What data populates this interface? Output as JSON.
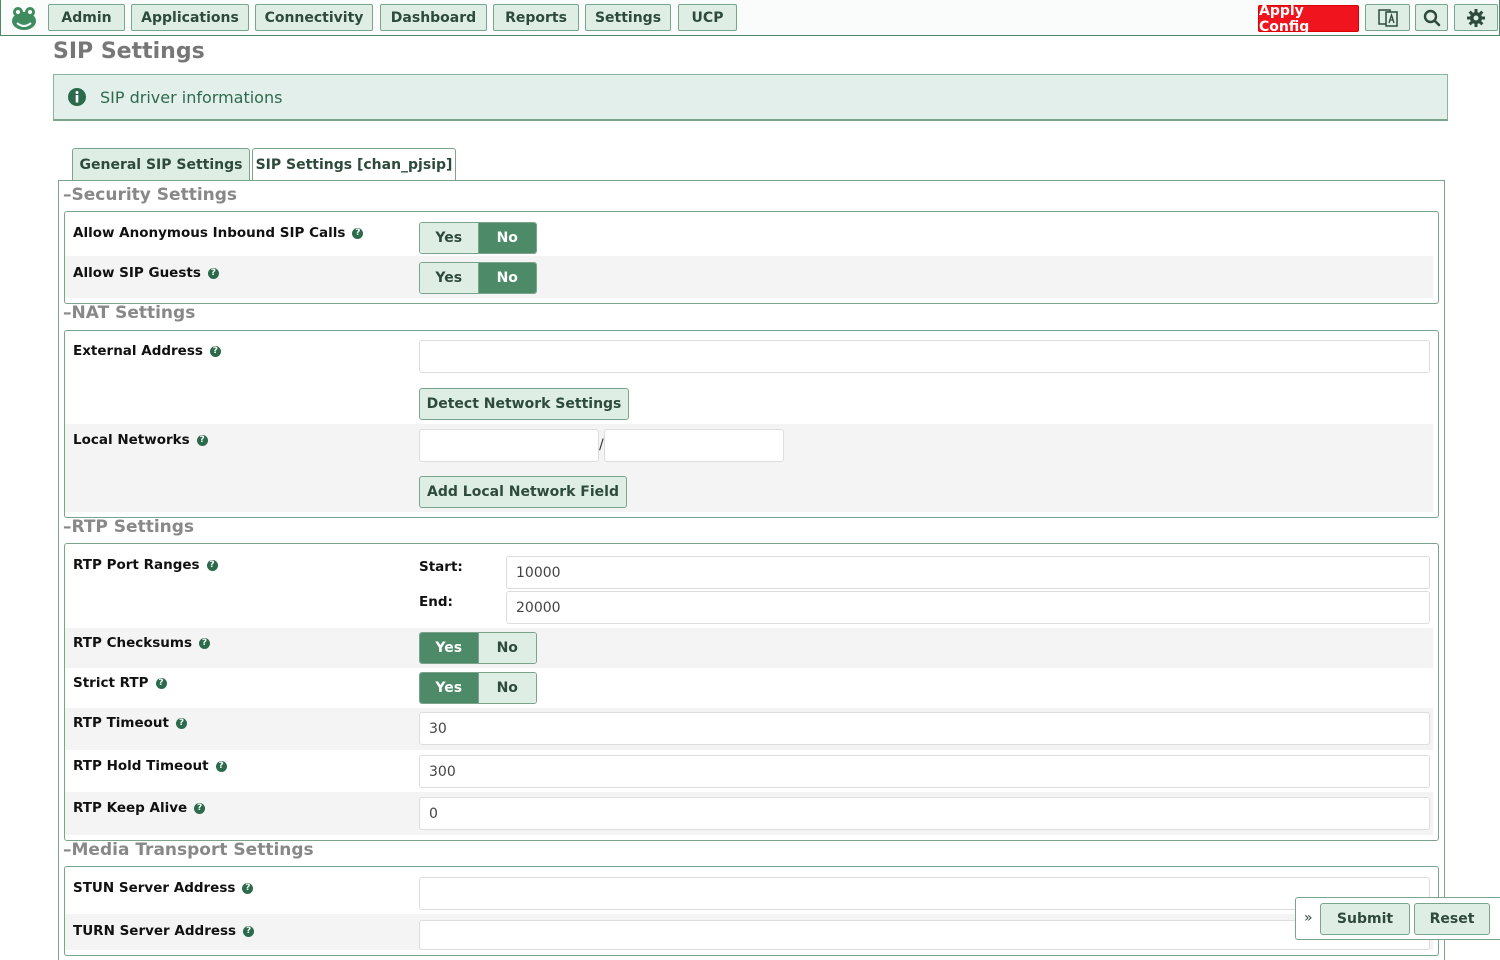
{
  "nav": {
    "items": [
      {
        "label": "Admin"
      },
      {
        "label": "Applications"
      },
      {
        "label": "Connectivity"
      },
      {
        "label": "Dashboard"
      },
      {
        "label": "Reports"
      },
      {
        "label": "Settings"
      },
      {
        "label": "UCP"
      }
    ],
    "apply_config": "Apply Config",
    "icons": [
      "logo-frog-icon",
      "language-icon",
      "search-icon",
      "gear-icon"
    ],
    "colors": {
      "accent": "#4d8a68",
      "apply": "#f0141e",
      "button_bg": "#dfeee5"
    }
  },
  "page": {
    "title": "SIP Settings",
    "info": "SIP driver informations"
  },
  "tabs": [
    {
      "label": "General SIP Settings",
      "active": true
    },
    {
      "label": "SIP Settings [chan_pjsip]",
      "active": false
    }
  ],
  "sections": {
    "security": {
      "title": "Security Settings",
      "anonymous": {
        "label": "Allow Anonymous Inbound SIP Calls",
        "yes": "Yes",
        "no": "No",
        "value": "No"
      },
      "guests": {
        "label": "Allow SIP Guests",
        "yes": "Yes",
        "no": "No",
        "value": "No"
      }
    },
    "nat": {
      "title": "NAT Settings",
      "external": {
        "label": "External Address",
        "value": ""
      },
      "detect_button": "Detect Network Settings",
      "local": {
        "label": "Local Networks",
        "network": "",
        "separator": "/",
        "mask": ""
      },
      "add_button": "Add Local Network Field"
    },
    "rtp": {
      "title": "RTP Settings",
      "ports": {
        "label": "RTP Port Ranges",
        "start_label": "Start:",
        "start": "10000",
        "end_label": "End:",
        "end": "20000"
      },
      "checksums": {
        "label": "RTP Checksums",
        "yes": "Yes",
        "no": "No",
        "value": "Yes"
      },
      "strict": {
        "label": "Strict RTP",
        "yes": "Yes",
        "no": "No",
        "value": "Yes"
      },
      "timeout": {
        "label": "RTP Timeout",
        "value": "30"
      },
      "hold_timeout": {
        "label": "RTP Hold Timeout",
        "value": "300"
      },
      "keep_alive": {
        "label": "RTP Keep Alive",
        "value": "0"
      }
    },
    "media": {
      "title": "Media Transport Settings",
      "stun": {
        "label": "STUN Server Address",
        "value": ""
      },
      "turn": {
        "label": "TURN Server Address",
        "value": ""
      }
    }
  },
  "footer": {
    "submit": "Submit",
    "reset": "Reset"
  }
}
